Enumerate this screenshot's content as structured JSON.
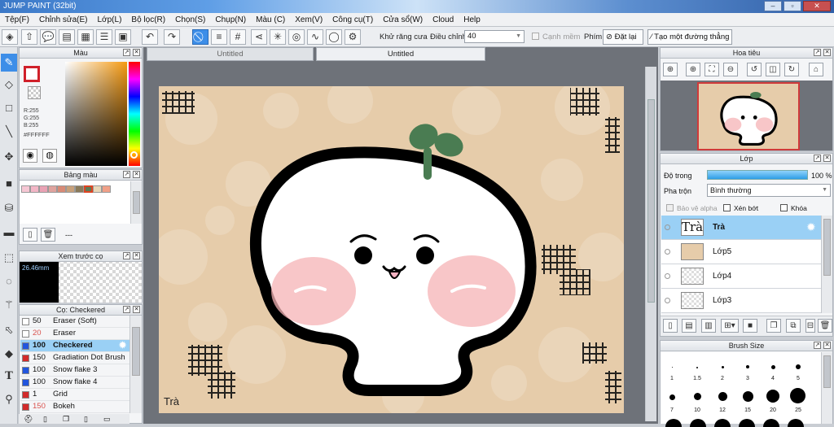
{
  "app": {
    "title": "JUMP PAINT (32bit)"
  },
  "menu": [
    "Tệp(F)",
    "Chỉnh sửa(E)",
    "Lớp(L)",
    "Bộ lọc(R)",
    "Chọn(S)",
    "Chụp(N)",
    "Màu (C)",
    "Xem(V)",
    "Công cụ(T)",
    "Cửa sổ(W)",
    "Cloud",
    "Help"
  ],
  "toolbar": {
    "antialias_label": "Khử răng cưa",
    "adjust_label": "Điều chỉnh",
    "adjust_value": "40",
    "edge_label": "Cạnh mềm",
    "key_label": "Phím",
    "reset_label": "Đặt lại",
    "line_label": "Tạo một đường thẳng"
  },
  "color_panel": {
    "title": "Màu",
    "r": "R:255",
    "g": "G:255",
    "b": "B:255",
    "hex": "#FFFFFF"
  },
  "palette_panel": {
    "title": "Bảng màu",
    "dash": "---",
    "swatches": [
      "#f6c7d4",
      "#f2b6c6",
      "#e9a2b4",
      "#dfa39e",
      "#d88a76",
      "#c7a07a",
      "#8a7a5a",
      "#5f7a55",
      "#e8d7b9",
      "#f0a088"
    ]
  },
  "preview_panel": {
    "title": "Xem trước cọ",
    "size": "26.46mm"
  },
  "brush_panel": {
    "title": "Cọ: Checkered",
    "items": [
      {
        "size": "50",
        "name": "Eraser (Soft)",
        "color": "#ffffff",
        "size_color": "#111111"
      },
      {
        "size": "20",
        "name": "Eraser",
        "color": "#ffffff",
        "size_color": "#d9534f"
      },
      {
        "size": "100",
        "name": "Checkered",
        "color": "#2255dd",
        "size_color": "#111111"
      },
      {
        "size": "150",
        "name": "Gradiation Dot Brush",
        "color": "#d22b2b",
        "size_color": "#111111"
      },
      {
        "size": "100",
        "name": "Snow flake 3",
        "color": "#2255dd",
        "size_color": "#111111"
      },
      {
        "size": "100",
        "name": "Snow flake 4",
        "color": "#2255dd",
        "size_color": "#111111"
      },
      {
        "size": "1",
        "name": "Grid",
        "color": "#d22b2b",
        "size_color": "#111111"
      },
      {
        "size": "150",
        "name": "Bokeh",
        "color": "#d22b2b",
        "size_color": "#d9534f"
      }
    ]
  },
  "tabs": [
    "Untitled",
    "Untitled"
  ],
  "canvas": {
    "caption": "Trà"
  },
  "navigator": {
    "title": "Hoa tiêu"
  },
  "layer_panel": {
    "title": "Lớp",
    "opacity_label": "Độ trong",
    "opacity_value": "100 %",
    "blend_label": "Pha trộn",
    "blend_value": "Bình thường",
    "protect_alpha": "Bảo vệ alpha",
    "clip": "Xén bớt",
    "lock": "Khóa",
    "layers": [
      {
        "name": "Trà",
        "thumb": "Trà"
      },
      {
        "name": "Lớp5",
        "thumb": ""
      },
      {
        "name": "Lớp4",
        "thumb": ""
      },
      {
        "name": "Lớp3",
        "thumb": ""
      }
    ]
  },
  "brush_size_panel": {
    "title": "Brush Size",
    "sizes_row1": [
      "1",
      "1.5",
      "2",
      "3",
      "4",
      "5"
    ],
    "sizes_row2": [
      "7",
      "10",
      "12",
      "15",
      "20",
      "25"
    ]
  },
  "colors": {
    "accent": "#3d8ee8",
    "selected_row": "#9ad0f5"
  }
}
